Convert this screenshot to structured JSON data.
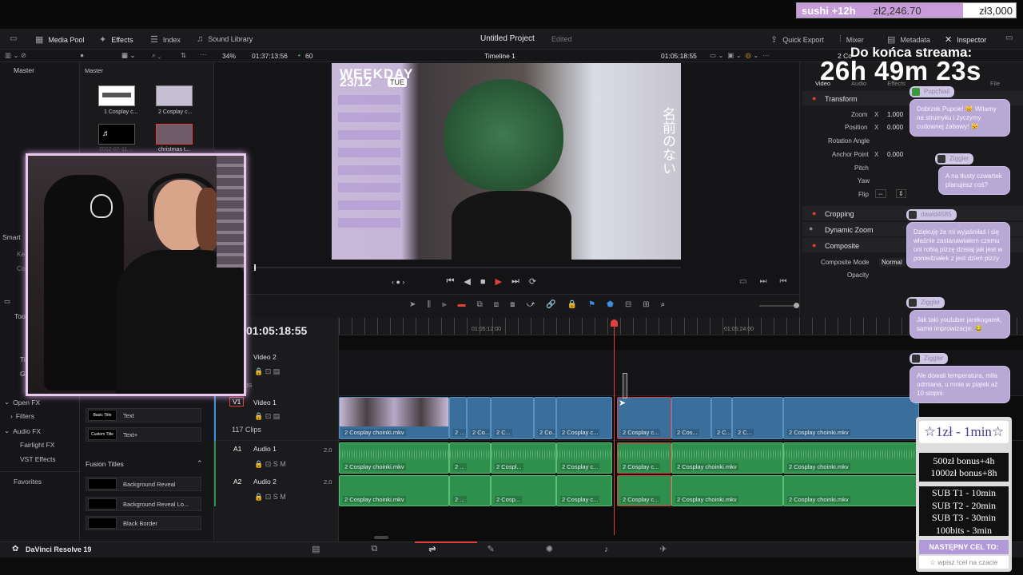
{
  "overlay_top": {
    "left": "sushi +12h",
    "mid": "zł2,246.70",
    "right": "zł3,000"
  },
  "stream_timer": {
    "label": "Do końca streama:",
    "value": "26h 49m 23s"
  },
  "topbar": {
    "media_pool": "Media Pool",
    "effects": "Effects",
    "index": "Index",
    "sound_library": "Sound Library",
    "project_title": "Untitled Project",
    "project_status": "Edited",
    "quick_export": "Quick Export",
    "mixer": "Mixer",
    "metadata": "Metadata",
    "inspector": "Inspector"
  },
  "subbar": {
    "zoom": "34%",
    "src_timecode": "01:37:13:56",
    "fps": "60",
    "timeline_name": "Timeline 1",
    "rec_timecode": "01:05:18:55",
    "inspector_clip": "2 Co"
  },
  "media_pool": {
    "master_left": "Master",
    "master_right": "Master",
    "clips": [
      {
        "name": "1 Cosplay c..."
      },
      {
        "name": "2 Cosplay c..."
      },
      {
        "name": "2022-07-11 ..."
      },
      {
        "name": "christmas t..."
      }
    ]
  },
  "viewer": {
    "date_overlay": "23/12",
    "day_overlay": "TUE",
    "weekday_overlay": "WEEKDAY",
    "side_text": "名前のない"
  },
  "effects_panel": {
    "smart": "Smart",
    "ke": "Ke",
    "co": "Co",
    "too": "Too",
    "ti": "Ti",
    "ge": "G",
    "open_fx": "Open FX",
    "filters": "Filters",
    "audio_fx": "Audio FX",
    "fairlight_fx": "Fairlight FX",
    "vst_effects": "VST Effects",
    "favorites": "Favorites",
    "basic_title": "Text",
    "custom_title": "Text+",
    "basic_title_thumb": "Basic Title",
    "custom_title_thumb": "Custom Title",
    "fusion_titles": "Fusion Titles",
    "fusion_items": [
      "Background Reveal",
      "Background Reveal Lo...",
      "Black Border"
    ]
  },
  "timeline": {
    "timecode": "01:05:18:55",
    "ruler": [
      "01:05:12:00",
      "01:05:24:00"
    ],
    "tracks": {
      "v2": {
        "name": "Video 2",
        "clips_note": "ps"
      },
      "v1": {
        "id": "V1",
        "name": "Video 1",
        "clips": "117 Clips"
      },
      "a1": {
        "id": "A1",
        "name": "Audio 1",
        "level": "2.0"
      },
      "a2": {
        "id": "A2",
        "name": "Audio 2",
        "level": "2.0"
      }
    },
    "clip_labels": {
      "full": "2 Cosplay choinki.mkv",
      "short2": "2 ...",
      "short_co": "2 Co...",
      "short_c": "2 C...",
      "cos": "2 Cos...",
      "cosplay_c": "2 Cosplay c...",
      "cospl": "2 Cospl...",
      "cosp": "2 Cosp..."
    }
  },
  "inspector": {
    "tabs": [
      "Video",
      "Audio",
      "Effects",
      "File"
    ],
    "transform": "Transform",
    "zoom_label": "Zoom",
    "zoom_x": "1.000",
    "position_label": "Position",
    "pos_x": "0.000",
    "rotation": "Rotation Angle",
    "anchor": "Anchor Point",
    "anchor_x": "0.000",
    "pitch": "Pitch",
    "yaw": "Yaw",
    "flip": "Flip",
    "cropping": "Cropping",
    "dynamic_zoom": "Dynamic Zoom",
    "composite": "Composite",
    "composite_mode_label": "Composite Mode",
    "composite_mode": "Normal",
    "opacity": "Opacity",
    "x": "X"
  },
  "chat": [
    {
      "user": "PupcNail",
      "text": "Dobrzek Pupcie! 😸 Witamy na strumyku i życzymy cudownej zabawy! 😸"
    },
    {
      "user": "Ziggler",
      "text": "A na tłusty czwartek planujesz coś?"
    },
    {
      "user": "dawid4585",
      "text": "Dziękuję że mi wyjaśniłaś i się właśnie zastanawiałem czemu oni robią pizzę dzisiaj jak jest w poniedziałek z jest dzień pizzy"
    },
    {
      "user": "Ziggler",
      "text": "Jak taki youtuber jarekogarek, same improwizacje. 😂"
    },
    {
      "user": "Ziggler",
      "text": "Ale dowali temperatura, miła odmiana, u mnie w piątek aż 10 stopni."
    }
  ],
  "goals": {
    "rate": "☆1zł - 1min☆",
    "bonus1": "500zł bonus+4h",
    "bonus2": "1000zł bonus+8h",
    "sub1": "SUB T1 - 10min",
    "sub2": "SUB T2 - 20min",
    "sub3": "SUB T3 - 30min",
    "bits": "100bits - 3min",
    "next": "NASTĘPNY CEL TO:",
    "input": "☆ wpisz !cel na czacie"
  },
  "app_name": "DaVinci Resolve 19",
  "colors": {
    "accent_red": "#e0403a",
    "video_clip": "#3a6f9b",
    "audio_clip": "#2f8f4d",
    "chat_bubble": "#b7a8d6"
  }
}
